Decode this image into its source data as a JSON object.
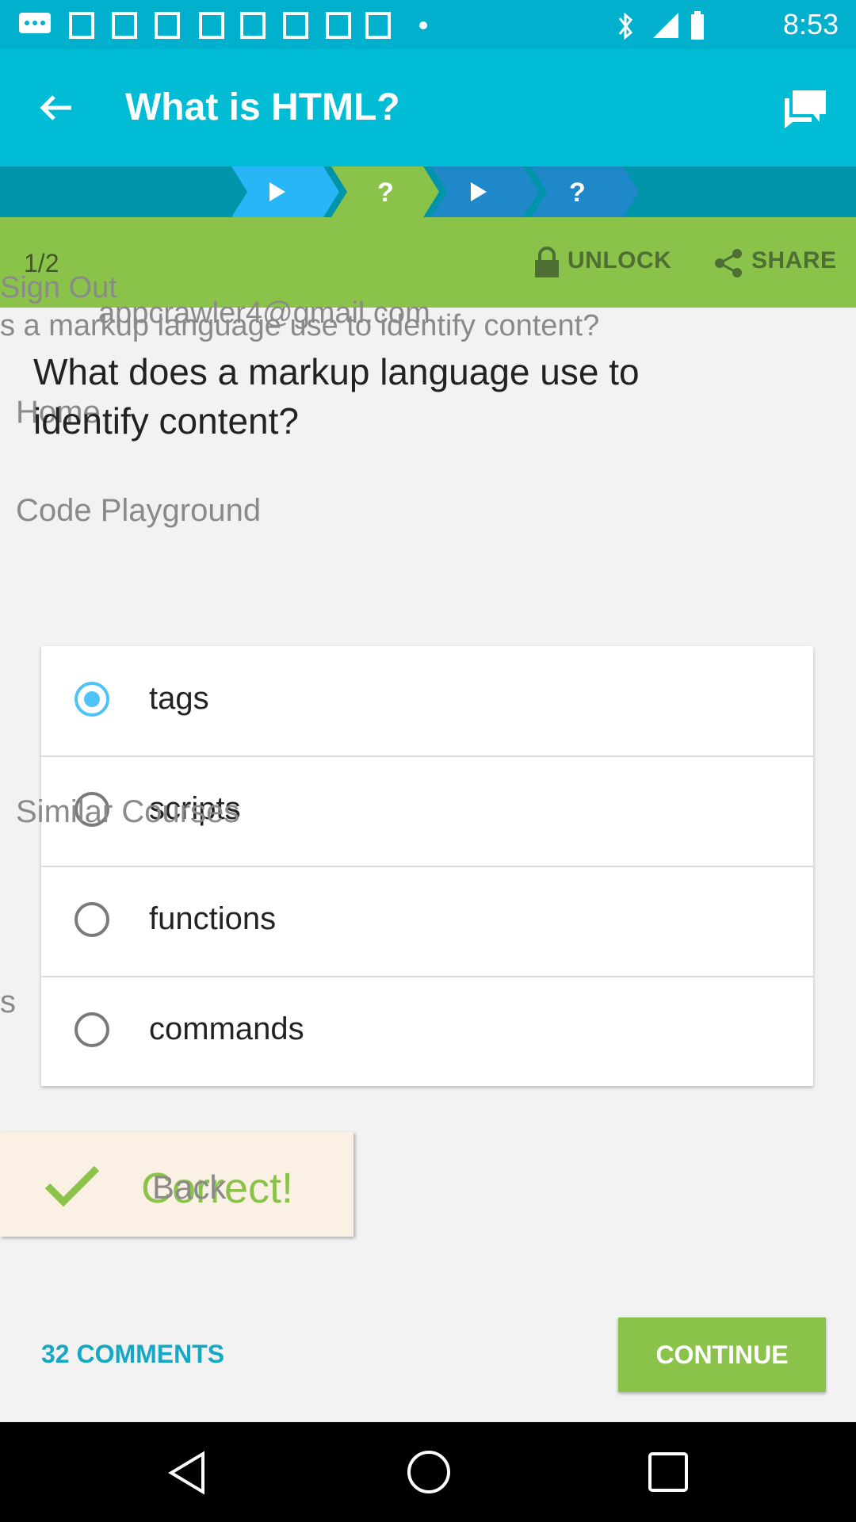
{
  "status_bar": {
    "time": "8:53"
  },
  "toolbar": {
    "title": "What is HTML?"
  },
  "lesson_bar": {
    "page": "1/2",
    "unlock_label": "UNLOCK",
    "share_label": "SHARE"
  },
  "drawer_ghost": {
    "sign_out": "Sign Out",
    "email": "appcrawler4@gmail.com",
    "home": "Home",
    "code_playground": "Code Playground",
    "similar_courses": "Similar Courses",
    "partial_s": "s",
    "back": "Back",
    "question_partial": "s a markup language use to identify content?"
  },
  "question": "What does a markup language use to identify content?",
  "options": [
    {
      "label": "tags",
      "selected": true
    },
    {
      "label": "scripts",
      "selected": false
    },
    {
      "label": "functions",
      "selected": false
    },
    {
      "label": "commands",
      "selected": false
    }
  ],
  "feedback": {
    "text": "Correct!"
  },
  "comments": {
    "label": "32 COMMENTS"
  },
  "continue": {
    "label": "CONTINUE"
  },
  "colors": {
    "primary": "#00bcd4",
    "accent": "#8bc34a",
    "selected": "#4fc3f7"
  }
}
